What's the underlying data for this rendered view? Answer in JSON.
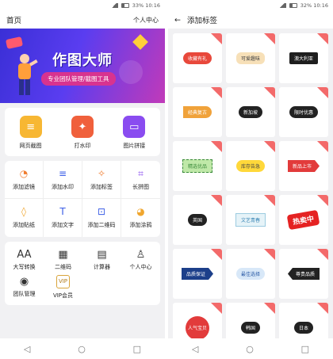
{
  "status": {
    "left": "",
    "right": "33% 10:16",
    "right2": "32% 10:16"
  },
  "left": {
    "header": {
      "title": "首页",
      "action": "个人中心"
    },
    "banner": {
      "title": "作图大师",
      "subtitle": "专业团队管理/截图工具"
    },
    "main_tools": [
      {
        "label": "网页截图",
        "icon": "screenshot-icon",
        "color": "#f7b733"
      },
      {
        "label": "打水印",
        "icon": "watermark-icon",
        "color": "#f0603c"
      },
      {
        "label": "图片拼接",
        "icon": "collage-icon",
        "color": "#8a4cf0"
      }
    ],
    "grid": [
      {
        "label": "添加滤镜",
        "icon": "filter-icon",
        "color": "#f07c2e"
      },
      {
        "label": "添加水印",
        "icon": "sliders-icon",
        "color": "#3a5de6"
      },
      {
        "label": "添加标签",
        "icon": "wand-icon",
        "color": "#f07c2e"
      },
      {
        "label": "长拼图",
        "icon": "crop-icon",
        "color": "#8a4cf0"
      },
      {
        "label": "添加贴纸",
        "icon": "drop-icon",
        "color": "#f0a62e"
      },
      {
        "label": "添加文字",
        "icon": "text-icon",
        "color": "#3a5de6"
      },
      {
        "label": "添加二维码",
        "icon": "qr-scan-icon",
        "color": "#3a5de6"
      },
      {
        "label": "添加涂鸦",
        "icon": "palette-icon",
        "color": "#f0a62e"
      }
    ],
    "more": [
      {
        "label": "大写转换",
        "glyph": "AA"
      },
      {
        "label": "二维码",
        "glyph": "▦"
      },
      {
        "label": "计算器",
        "glyph": "▤"
      },
      {
        "label": "个人中心",
        "glyph": "♙"
      },
      {
        "label": "团队管理",
        "glyph": "◉"
      },
      {
        "label": "VIP会员",
        "glyph": "VIP"
      }
    ]
  },
  "right": {
    "header": {
      "back": "←",
      "title": "添加标签"
    },
    "tags": [
      {
        "text": "收藏有礼",
        "bg": "#e8483b",
        "shape": "pill"
      },
      {
        "text": "可爱趣味",
        "bg": "#f7e0b8",
        "fg": "#444",
        "shape": "bunny"
      },
      {
        "text": "澳大利亚",
        "bg": "#1e1e1e",
        "shape": "flag"
      },
      {
        "text": "经典复古",
        "bg": "#f0a23a",
        "shape": "leaf"
      },
      {
        "text": "新加坡",
        "bg": "#222",
        "shape": "pill"
      },
      {
        "text": "限时优惠",
        "bg": "#222",
        "shape": "pill"
      },
      {
        "text": "精选优品",
        "bg": "#bfe8a8",
        "fg": "#3a8a3a",
        "shape": "stamp"
      },
      {
        "text": "库存告急",
        "bg": "#ffd83a",
        "fg": "#444",
        "shape": "pill"
      },
      {
        "text": "新品上市",
        "bg": "#e23b3b",
        "shape": "arrow"
      },
      {
        "text": "英国",
        "bg": "#222",
        "shape": "pill"
      },
      {
        "text": "文艺青春",
        "bg": "#e6f3f8",
        "fg": "#3a86b5",
        "shape": "ribbon"
      },
      {
        "text": "热卖中",
        "bg": "#e52222",
        "shape": "burst"
      },
      {
        "text": "品质保证",
        "bg": "#1c3f8a",
        "shape": "arrow"
      },
      {
        "text": "最佳选择",
        "bg": "#d8e8f8",
        "fg": "#2a5aa5",
        "shape": "pill"
      },
      {
        "text": "尊贵品质",
        "bg": "#222",
        "shape": "arrowleft"
      },
      {
        "text": "人气宝贝",
        "bg": "#e23b3b",
        "shape": "circle"
      },
      {
        "text": "韩国",
        "bg": "#222",
        "shape": "pill"
      },
      {
        "text": "日本",
        "bg": "#222",
        "shape": "pill"
      }
    ]
  },
  "nav": {
    "back": "◁",
    "home": "○",
    "recent": "□"
  }
}
